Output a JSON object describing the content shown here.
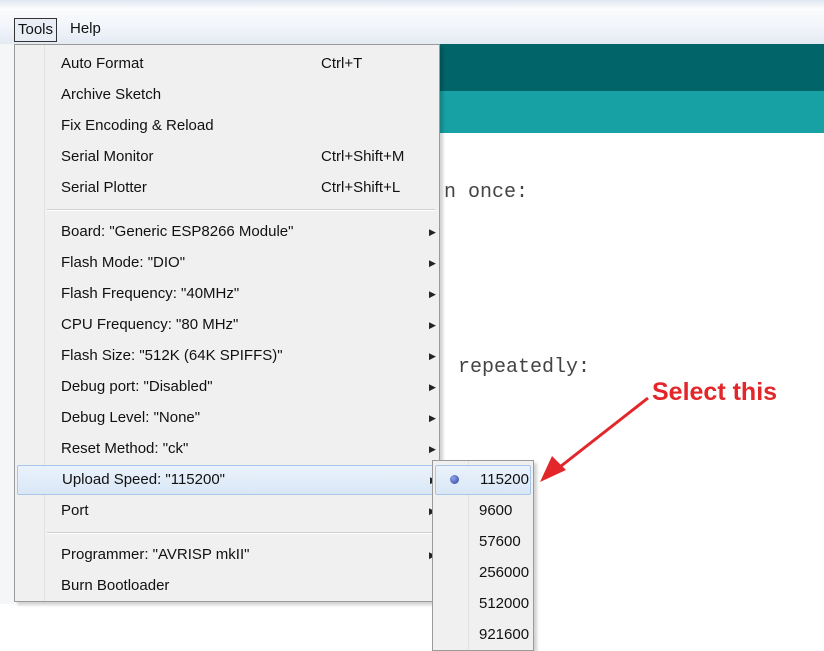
{
  "menubar": {
    "tools_label": "Tools",
    "help_label": "Help"
  },
  "editor": {
    "line_setup_fragment": "n once:",
    "line_loop_fragment": "repeatedly:"
  },
  "tools_menu": {
    "items": [
      {
        "label": "Auto Format",
        "shortcut": "Ctrl+T"
      },
      {
        "label": "Archive Sketch",
        "shortcut": ""
      },
      {
        "label": "Fix Encoding & Reload",
        "shortcut": ""
      },
      {
        "label": "Serial Monitor",
        "shortcut": "Ctrl+Shift+M"
      },
      {
        "label": "Serial Plotter",
        "shortcut": "Ctrl+Shift+L"
      },
      {
        "label": "Board: \"Generic ESP8266 Module\""
      },
      {
        "label": "Flash Mode: \"DIO\""
      },
      {
        "label": "Flash Frequency: \"40MHz\""
      },
      {
        "label": "CPU Frequency: \"80 MHz\""
      },
      {
        "label": "Flash Size: \"512K (64K SPIFFS)\""
      },
      {
        "label": "Debug port: \"Disabled\""
      },
      {
        "label": "Debug Level: \"None\""
      },
      {
        "label": "Reset Method: \"ck\""
      },
      {
        "label": "Upload Speed: \"115200\""
      },
      {
        "label": "Port"
      },
      {
        "label": "Programmer: \"AVRISP mkII\""
      },
      {
        "label": "Burn Bootloader"
      }
    ]
  },
  "upload_speed_submenu": {
    "options": [
      "115200",
      "9600",
      "57600",
      "256000",
      "512000",
      "921600"
    ],
    "selected": "115200"
  },
  "annotation": {
    "text": "Select this",
    "color": "#e3262a"
  },
  "colors": {
    "editor_header": "#006468",
    "editor_tabs": "#17a1a5",
    "menu_highlight": "#d9e7f6"
  }
}
